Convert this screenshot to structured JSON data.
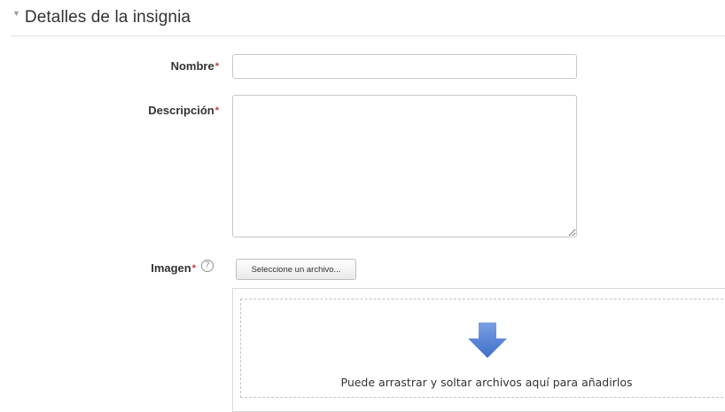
{
  "section": {
    "title": "Detalles de la insignia",
    "collapse_icon": "triangle-down-icon"
  },
  "fields": {
    "nombre": {
      "label": "Nombre",
      "required_marker": "*",
      "value": ""
    },
    "descripcion": {
      "label": "Descripción",
      "required_marker": "*",
      "value": ""
    },
    "imagen": {
      "label": "Imagen",
      "required_marker": "*",
      "help_icon": "question-circle-icon",
      "help_glyph": "?",
      "button_label": "Seleccione un archivo...",
      "dropzone_icon": "arrow-down-icon",
      "dropzone_text": "Puede arrastrar y soltar archivos aquí para añadirlos"
    }
  },
  "colors": {
    "required": "#c43b3b",
    "arrow": "#5b86d6",
    "text": "#333333"
  }
}
